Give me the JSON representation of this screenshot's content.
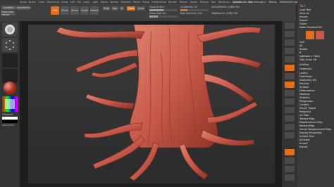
{
  "menu": [
    "Alpha",
    "Brush",
    "Color",
    "Document",
    "Draw",
    "Edit",
    "File",
    "Layer",
    "Light",
    "Macro",
    "Marker",
    "Material",
    "Movie",
    "Picker",
    "Preferences",
    "Render",
    "Stencil",
    "Stroke",
    "Texture",
    "Tool",
    "Transform",
    "Zplugin",
    "Zscript"
  ],
  "top_info": {
    "quicksave": "QuickSave",
    "see_through": "See-through 0",
    "menus": "Menus",
    "default_script": "DefaultZScript"
  },
  "toolbar": {
    "lightbox": "LightBox",
    "projection": "Projection Master",
    "quicksketch": "QuickSketch",
    "edit": "Edit",
    "draw": "Draw",
    "move": "Move",
    "scale": "Scale",
    "rotate": "Rotate",
    "mrgb": "Mrgb",
    "rgb": "Rgb",
    "m": "M",
    "zadd": "Zadd",
    "zsub": "Zsub",
    "focal_shift": "Focal Shift 0",
    "draw_size": "Draw Size 64",
    "z_intensity": "Z Intensity 25",
    "rgb_intensity": "Rgb Intensity 100",
    "active_points": "ActivePoints: 4.882 Mil",
    "total_points": "TotalPoints: 4.882 Mil"
  },
  "tray": {
    "title": "Tool",
    "items": [
      "Load Tool",
      "Save As",
      "Import",
      "Export",
      "Clone",
      "Make PolyMesh3D",
      "GoZ",
      "All",
      "Visible",
      "R",
      "Lightbox > Tools",
      "Tree_trunk 48",
      "SubTool",
      "Geometry",
      "Layers",
      "FiberMesh",
      "Geometry HD",
      "Preview",
      "Surface",
      "Deformation",
      "Masking",
      "Visibility",
      "Polygroups",
      "Contact",
      "Morph Target",
      "Polypaint",
      "UV Map",
      "Texture Map",
      "Displacement Map",
      "Normal Map",
      "Vector Displacement Map",
      "Display Properties",
      "Unified Skin",
      "Initialize",
      "Import",
      "Export"
    ]
  },
  "left_shelf": {
    "gradient": "Gradient",
    "switch_color": "SwitchColor",
    "alternate": "Alternate"
  },
  "colors": {
    "accent": "#e0701f",
    "clay": "#c85a4c",
    "bg": "#2a2a2a"
  }
}
